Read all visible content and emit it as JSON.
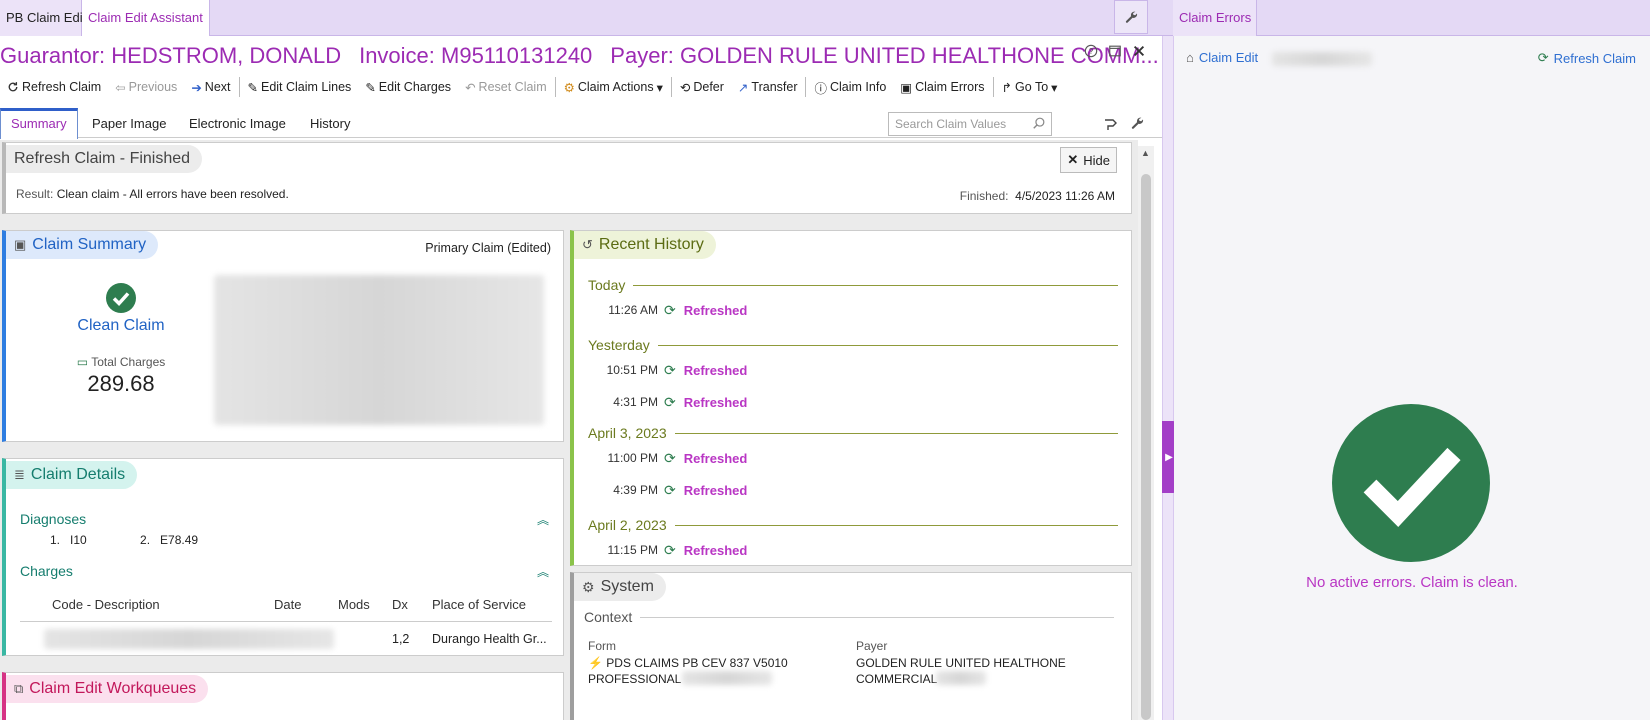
{
  "tabs": {
    "pb_claim_edit": "PB Claim Edit",
    "assistant": "Claim Edit Assistant",
    "claim_errors": "Claim Errors"
  },
  "title": {
    "guarantor": "Guarantor: HEDSTROM, DONALD",
    "invoice": "Invoice: M95110131240",
    "payer": "Payer: GOLDEN RULE UNITED HEALTHONE COMM..."
  },
  "toolbar": {
    "refresh": "Refresh Claim",
    "previous": "Previous",
    "next": "Next",
    "edit_lines": "Edit Claim Lines",
    "edit_charges": "Edit Charges",
    "reset": "Reset Claim",
    "actions": "Claim Actions",
    "defer": "Defer",
    "transfer": "Transfer",
    "info": "Claim Info",
    "errors": "Claim Errors",
    "goto": "Go To"
  },
  "subtabs": {
    "summary": "Summary",
    "paper": "Paper Image",
    "electronic": "Electronic Image",
    "history": "History"
  },
  "search": {
    "placeholder": "Search Claim Values"
  },
  "refresh_panel": {
    "title": "Refresh Claim - Finished",
    "hide": "Hide",
    "result_label": "Result:",
    "result_text": "Clean claim - All errors have been resolved.",
    "finished_label": "Finished:",
    "finished_value": "4/5/2023 11:26 AM"
  },
  "claim_summary": {
    "title": "Claim Summary",
    "primary": "Primary Claim (Edited)",
    "status": "Clean Claim",
    "total_label": "Total Charges",
    "total_value": "289.68"
  },
  "claim_details": {
    "title": "Claim Details",
    "diagnoses_label": "Diagnoses",
    "dx1_num": "1.",
    "dx1": "I10",
    "dx2_num": "2.",
    "dx2": "E78.49",
    "charges_label": "Charges",
    "headers": {
      "code": "Code - Description",
      "date": "Date",
      "mods": "Mods",
      "dx": "Dx",
      "pos": "Place of Service"
    },
    "row_dx": "1,2",
    "row_pos": "Durango Health Gr..."
  },
  "workqueues": {
    "title": "Claim Edit Workqueues"
  },
  "recent_history": {
    "title": "Recent History",
    "day_today": "Today",
    "day_yesterday": "Yesterday",
    "day_apr3": "April 3, 2023",
    "day_apr2": "April 2, 2023",
    "times": [
      "11:26 AM",
      "10:51 PM",
      "4:31 PM",
      "11:00 PM",
      "4:39 PM",
      "11:15 PM"
    ],
    "event": "Refreshed"
  },
  "system": {
    "title": "System",
    "context": "Context",
    "form_label": "Form",
    "form_value_1": "PDS CLAIMS PB CEV 837 V5010",
    "form_value_2": "PROFESSIONAL",
    "payer_label": "Payer",
    "payer_value_1": "GOLDEN RULE UNITED HEALTHONE",
    "payer_value_2": "COMMERCIAL"
  },
  "right_panel": {
    "claim_edit": "Claim Edit",
    "refresh": "Refresh Claim",
    "message": "No active errors. Claim is clean."
  },
  "colors": {
    "accent": "#9c2bb3",
    "link": "#2f6fd1",
    "clean_green": "#2e7d4f",
    "history_olive": "#6b7a1f"
  }
}
